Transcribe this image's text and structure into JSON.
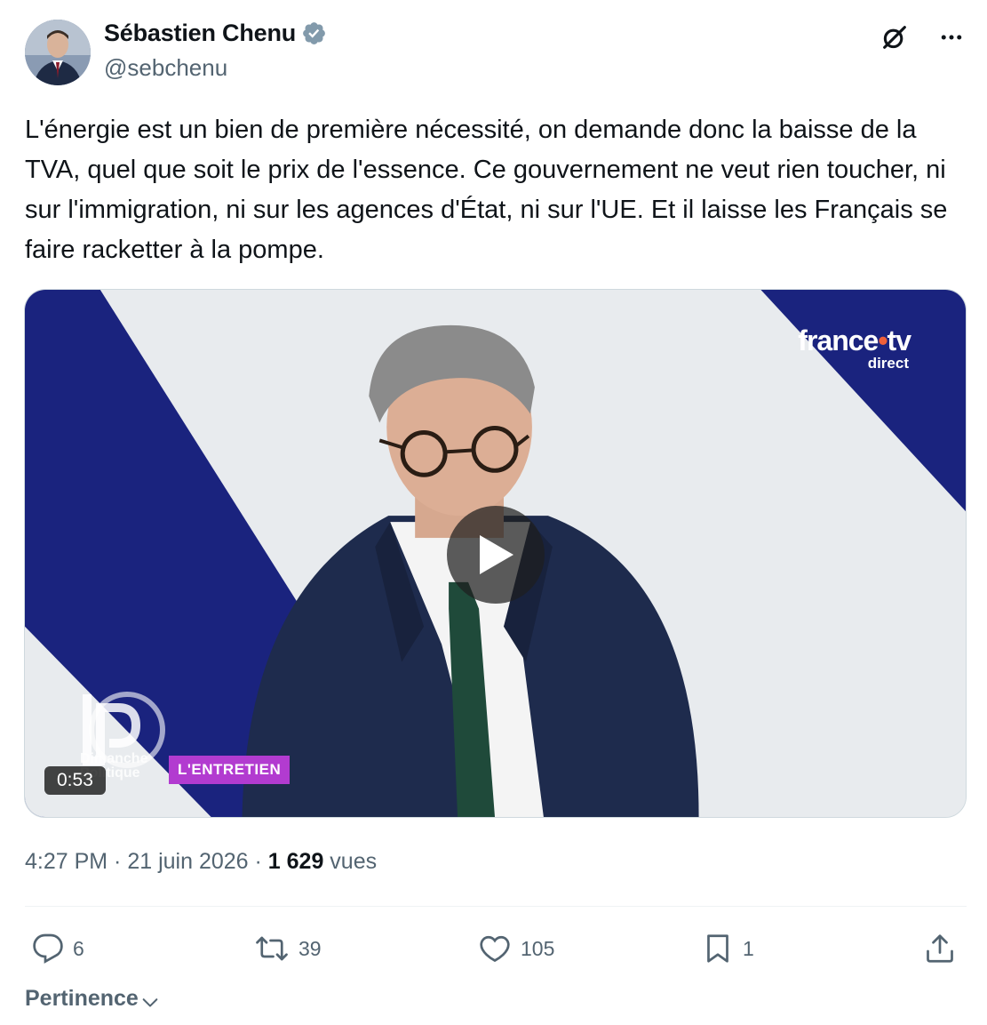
{
  "author": {
    "display_name": "Sébastien Chenu",
    "handle": "@sebchenu"
  },
  "tweet": {
    "text": "L'énergie est un bien de première nécessité, on demande donc la baisse de la TVA, quel que soit le prix de l'essence. Ce gouvernement ne veut rien toucher, ni sur l'immigration, ni sur les agences d'État, ni sur l'UE. Et il laisse les Français se faire racketter à la pompe.",
    "time": "4:27 PM",
    "separator": " · ",
    "date": "21 juin 2026",
    "views_count": "1 629",
    "views_label": " vues"
  },
  "video": {
    "duration": "0:53",
    "channel_brand_main": "france",
    "channel_brand_dot": "•",
    "channel_brand_suffix": "tv",
    "channel_brand_sub": "direct",
    "show_name_line1": "Dimanche",
    "show_name_line2": "Politique",
    "segment_label": "L'ENTRETIEN"
  },
  "engagement": {
    "replies": "6",
    "retweets": "39",
    "likes": "105",
    "bookmarks": "1"
  },
  "sort": {
    "label": "Pertinence"
  },
  "icons": {
    "verified": "verified-badge-icon",
    "grok": "grok-icon",
    "more": "more-icon",
    "play": "play-icon",
    "reply": "reply-icon",
    "retweet": "retweet-icon",
    "like": "heart-icon",
    "bookmark": "bookmark-icon",
    "share": "share-icon",
    "chevron": "chevron-down-icon"
  },
  "colors": {
    "text_primary": "#0f1419",
    "text_secondary": "#536471",
    "verified": "#829aab",
    "brand_dot": "#f0603a",
    "segment_bg": "#b23bd0",
    "stripe_blue": "#1a237e"
  }
}
